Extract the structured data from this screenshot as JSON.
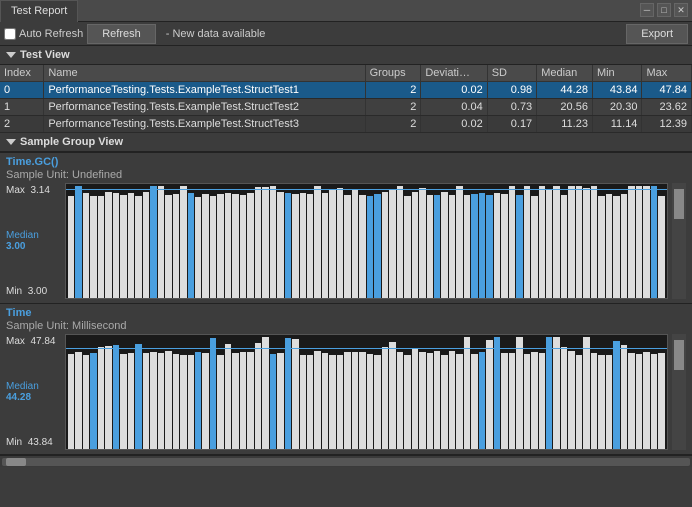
{
  "titleBar": {
    "title": "Test Report",
    "controls": [
      "minimize-icon",
      "maximize-icon",
      "close-icon"
    ]
  },
  "toolbar": {
    "autoRefreshLabel": "Auto Refresh",
    "refreshLabel": "Refresh",
    "newDataLabel": "- New data available",
    "exportLabel": "Export"
  },
  "testView": {
    "sectionLabel": "Test View",
    "columns": [
      "Index",
      "Name",
      "Groups",
      "Deviation",
      "SD",
      "Median",
      "Min",
      "Max"
    ],
    "rows": [
      {
        "index": "0",
        "name": "PerformanceTesting.Tests.ExampleTest.StructTest1",
        "groups": "2",
        "deviation": "0.02",
        "sd": "0.98",
        "median": "44.28",
        "min": "43.84",
        "max": "47.84",
        "selected": true
      },
      {
        "index": "1",
        "name": "PerformanceTesting.Tests.ExampleTest.StructTest2",
        "groups": "2",
        "deviation": "0.04",
        "sd": "0.73",
        "median": "20.56",
        "min": "20.30",
        "max": "23.62",
        "selected": false
      },
      {
        "index": "2",
        "name": "PerformanceTesting.Tests.ExampleTest.StructTest3",
        "groups": "2",
        "deviation": "0.02",
        "sd": "0.17",
        "median": "11.23",
        "min": "11.14",
        "max": "12.39",
        "selected": false
      }
    ]
  },
  "sampleGroupView": {
    "sectionLabel": "Sample Group View",
    "groups": [
      {
        "title": "Time.GC()",
        "sampleUnit": "Sample Unit: Undefined",
        "maxLabel": "Max",
        "maxValue": "3.14",
        "medianLabel": "Median",
        "medianValue": "3.00",
        "minLabel": "Min",
        "minValue": "3.00",
        "medianPercent": 95
      },
      {
        "title": "Time",
        "sampleUnit": "Sample Unit: Millisecond",
        "maxLabel": "Max",
        "maxValue": "47.84",
        "medianLabel": "Median",
        "medianValue": "44.28",
        "minLabel": "Min",
        "minValue": "43.84",
        "medianPercent": 88
      }
    ]
  },
  "icons": {
    "triangle_down": "▼",
    "minimize": "─",
    "maximize": "□",
    "close": "✕"
  }
}
